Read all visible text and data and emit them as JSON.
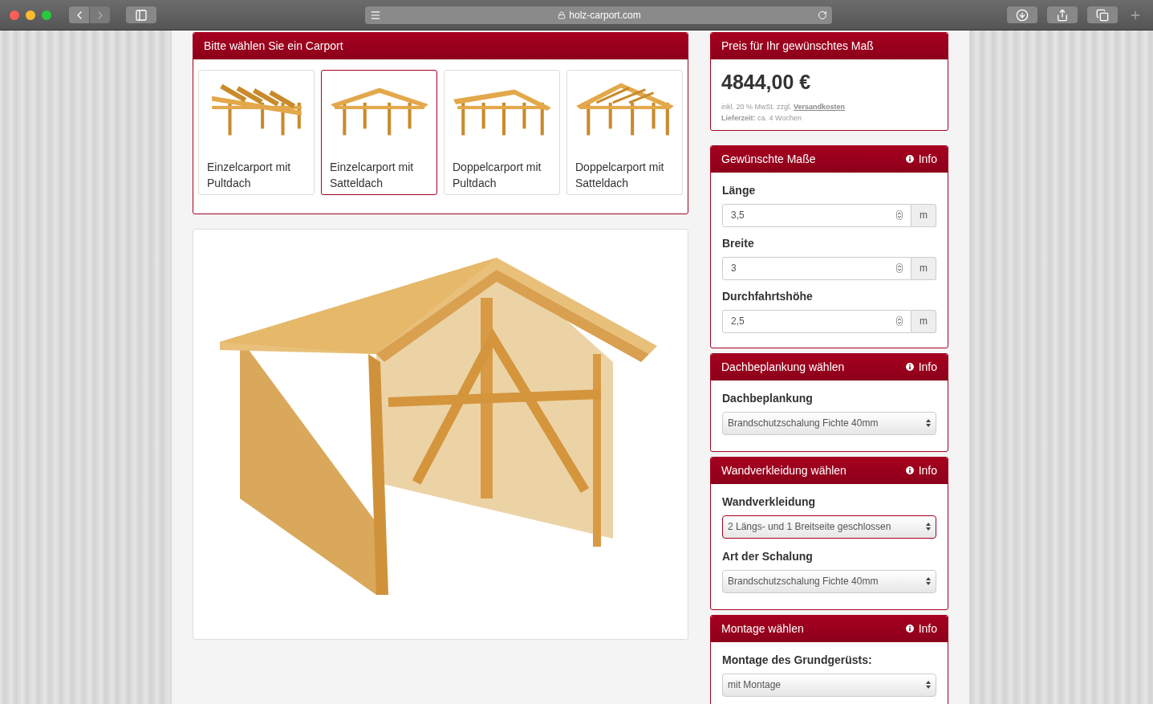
{
  "browser": {
    "url": "holz-carport.com"
  },
  "carport_panel": {
    "title": "Bitte wählen Sie ein Carport",
    "options": [
      {
        "label": "Einzelcarport mit Pultdach",
        "kind": "single-shed",
        "selected": false
      },
      {
        "label": "Einzelcarport mit Satteldach",
        "kind": "single-gable",
        "selected": true
      },
      {
        "label": "Doppelcarport mit Pultdach",
        "kind": "double-shed",
        "selected": false
      },
      {
        "label": "Doppelcarport mit Satteldach",
        "kind": "double-gable",
        "selected": false
      }
    ]
  },
  "price_panel": {
    "title": "Preis für Ihr gewünschtes Maß",
    "price": "4844,00 €",
    "tax_note": "inkl. 20 % MwSt. zzgl.",
    "shipping_link": "Versandkosten",
    "delivery_label": "Lieferzeit:",
    "delivery_value": "ca. 4 Wochen"
  },
  "panels": [
    {
      "title": "Gewünschte Maße",
      "info": "Info",
      "fields": [
        {
          "kind": "number",
          "label": "Länge",
          "value": "3,5",
          "unit": "m"
        },
        {
          "kind": "number",
          "label": "Breite",
          "value": "3",
          "unit": "m"
        },
        {
          "kind": "number",
          "label": "Durchfahrtshöhe",
          "value": "2,5",
          "unit": "m"
        }
      ]
    },
    {
      "title": "Dachbeplankung wählen",
      "info": "Info",
      "fields": [
        {
          "kind": "select",
          "label": "Dachbeplankung",
          "value": "Brandschutzschalung Fichte 40mm",
          "highlighted": false
        }
      ]
    },
    {
      "title": "Wandverkleidung wählen",
      "info": "Info",
      "fields": [
        {
          "kind": "select",
          "label": "Wandverkleidung",
          "value": "2 Längs- und 1 Breitseite geschlossen",
          "highlighted": true
        },
        {
          "kind": "select",
          "label": "Art der Schalung",
          "value": "Brandschutzschalung Fichte 40mm",
          "highlighted": false
        }
      ]
    },
    {
      "title": "Montage wählen",
      "info": "Info",
      "fields": [
        {
          "kind": "select",
          "label": "Montage des Grundgerüsts:",
          "value": "mit Montage",
          "highlighted": false
        }
      ]
    }
  ]
}
